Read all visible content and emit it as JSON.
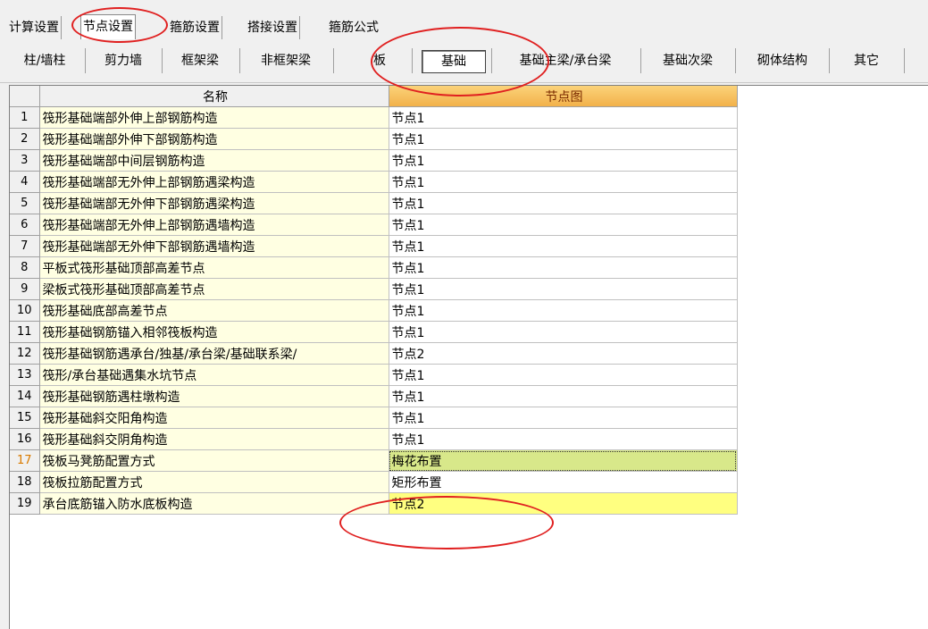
{
  "tabs": [
    "计算设置",
    "节点设置",
    "箍筋设置",
    "搭接设置",
    "箍筋公式"
  ],
  "active_tab": "节点设置",
  "toolbar": [
    "柱/墙柱",
    "剪力墙",
    "框架梁",
    "非框架梁",
    "板",
    "基础",
    "基础主梁/承台梁",
    "基础次梁",
    "砌体结构",
    "其它"
  ],
  "active_toolbar": "基础",
  "grid": {
    "col_name": "名称",
    "col_value": "节点图",
    "rows": [
      {
        "no": "1",
        "name": "筏形基础端部外伸上部钢筋构造",
        "value": "节点1"
      },
      {
        "no": "2",
        "name": "筏形基础端部外伸下部钢筋构造",
        "value": "节点1"
      },
      {
        "no": "3",
        "name": "筏形基础端部中间层钢筋构造",
        "value": "节点1"
      },
      {
        "no": "4",
        "name": "筏形基础端部无外伸上部钢筋遇梁构造",
        "value": "节点1"
      },
      {
        "no": "5",
        "name": "筏形基础端部无外伸下部钢筋遇梁构造",
        "value": "节点1"
      },
      {
        "no": "6",
        "name": "筏形基础端部无外伸上部钢筋遇墙构造",
        "value": "节点1"
      },
      {
        "no": "7",
        "name": "筏形基础端部无外伸下部钢筋遇墙构造",
        "value": "节点1"
      },
      {
        "no": "8",
        "name": "平板式筏形基础顶部高差节点",
        "value": "节点1"
      },
      {
        "no": "9",
        "name": "梁板式筏形基础顶部高差节点",
        "value": "节点1"
      },
      {
        "no": "10",
        "name": "筏形基础底部高差节点",
        "value": "节点1"
      },
      {
        "no": "11",
        "name": "筏形基础钢筋锚入相邻筏板构造",
        "value": "节点1"
      },
      {
        "no": "12",
        "name": "筏形基础钢筋遇承台/独基/承台梁/基础联系梁/",
        "value": "节点2"
      },
      {
        "no": "13",
        "name": "筏形/承台基础遇集水坑节点",
        "value": "节点1"
      },
      {
        "no": "14",
        "name": "筏形基础钢筋遇柱墩构造",
        "value": "节点1"
      },
      {
        "no": "15",
        "name": "筏形基础斜交阳角构造",
        "value": "节点1"
      },
      {
        "no": "16",
        "name": "筏形基础斜交阴角构造",
        "value": "节点1"
      },
      {
        "no": "17",
        "name": "筏板马凳筋配置方式",
        "value": "梅花布置"
      },
      {
        "no": "18",
        "name": "筏板拉筋配置方式",
        "value": "矩形布置"
      },
      {
        "no": "19",
        "name": "承台底筋锚入防水底板构造",
        "value": "节点2"
      }
    ]
  },
  "selected_row": "17",
  "colors": {
    "selected_value": "#d8e88a",
    "highlight_value": "#ffff80",
    "header_accent": "#f2b14a",
    "annotation": "#e02020"
  }
}
